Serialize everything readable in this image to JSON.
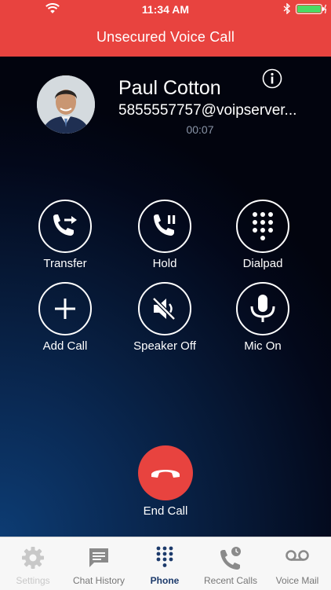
{
  "status_bar": {
    "time": "11:34 AM"
  },
  "header": {
    "title": "Unsecured Voice Call"
  },
  "caller": {
    "name": "Paul Cotton",
    "address": "5855557757@voipserver...",
    "duration": "00:07"
  },
  "controls": [
    {
      "label": "Transfer",
      "icon": "transfer-icon"
    },
    {
      "label": "Hold",
      "icon": "hold-icon"
    },
    {
      "label": "Dialpad",
      "icon": "dialpad-icon"
    },
    {
      "label": "Add Call",
      "icon": "plus-icon"
    },
    {
      "label": "Speaker Off",
      "icon": "speaker-off-icon"
    },
    {
      "label": "Mic On",
      "icon": "microphone-icon"
    }
  ],
  "end_call": {
    "label": "End Call"
  },
  "tabs": [
    {
      "label": "Settings",
      "icon": "gear-icon",
      "state": "disabled"
    },
    {
      "label": "Chat History",
      "icon": "chat-icon",
      "state": "normal"
    },
    {
      "label": "Phone",
      "icon": "dialpad-icon",
      "state": "active"
    },
    {
      "label": "Recent Calls",
      "icon": "recent-calls-icon",
      "state": "normal"
    },
    {
      "label": "Voice Mail",
      "icon": "voicemail-icon",
      "state": "normal"
    }
  ],
  "colors": {
    "header_red": "#e8433f",
    "end_call_red": "#e8433f",
    "active_tab": "#1c3a6b",
    "background_dark": "#03081a"
  }
}
